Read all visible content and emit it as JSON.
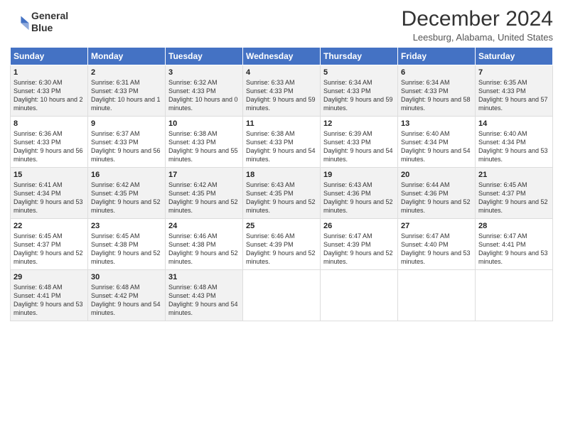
{
  "logo": {
    "line1": "General",
    "line2": "Blue"
  },
  "title": "December 2024",
  "location": "Leesburg, Alabama, United States",
  "header": {
    "save_label": "December 2024",
    "location_label": "Leesburg, Alabama, United States"
  },
  "columns": [
    "Sunday",
    "Monday",
    "Tuesday",
    "Wednesday",
    "Thursday",
    "Friday",
    "Saturday"
  ],
  "weeks": [
    [
      {
        "day": "1",
        "sunrise": "Sunrise: 6:30 AM",
        "sunset": "Sunset: 4:33 PM",
        "daylight": "Daylight: 10 hours and 2 minutes."
      },
      {
        "day": "2",
        "sunrise": "Sunrise: 6:31 AM",
        "sunset": "Sunset: 4:33 PM",
        "daylight": "Daylight: 10 hours and 1 minute."
      },
      {
        "day": "3",
        "sunrise": "Sunrise: 6:32 AM",
        "sunset": "Sunset: 4:33 PM",
        "daylight": "Daylight: 10 hours and 0 minutes."
      },
      {
        "day": "4",
        "sunrise": "Sunrise: 6:33 AM",
        "sunset": "Sunset: 4:33 PM",
        "daylight": "Daylight: 9 hours and 59 minutes."
      },
      {
        "day": "5",
        "sunrise": "Sunrise: 6:34 AM",
        "sunset": "Sunset: 4:33 PM",
        "daylight": "Daylight: 9 hours and 59 minutes."
      },
      {
        "day": "6",
        "sunrise": "Sunrise: 6:34 AM",
        "sunset": "Sunset: 4:33 PM",
        "daylight": "Daylight: 9 hours and 58 minutes."
      },
      {
        "day": "7",
        "sunrise": "Sunrise: 6:35 AM",
        "sunset": "Sunset: 4:33 PM",
        "daylight": "Daylight: 9 hours and 57 minutes."
      }
    ],
    [
      {
        "day": "8",
        "sunrise": "Sunrise: 6:36 AM",
        "sunset": "Sunset: 4:33 PM",
        "daylight": "Daylight: 9 hours and 56 minutes."
      },
      {
        "day": "9",
        "sunrise": "Sunrise: 6:37 AM",
        "sunset": "Sunset: 4:33 PM",
        "daylight": "Daylight: 9 hours and 56 minutes."
      },
      {
        "day": "10",
        "sunrise": "Sunrise: 6:38 AM",
        "sunset": "Sunset: 4:33 PM",
        "daylight": "Daylight: 9 hours and 55 minutes."
      },
      {
        "day": "11",
        "sunrise": "Sunrise: 6:38 AM",
        "sunset": "Sunset: 4:33 PM",
        "daylight": "Daylight: 9 hours and 54 minutes."
      },
      {
        "day": "12",
        "sunrise": "Sunrise: 6:39 AM",
        "sunset": "Sunset: 4:33 PM",
        "daylight": "Daylight: 9 hours and 54 minutes."
      },
      {
        "day": "13",
        "sunrise": "Sunrise: 6:40 AM",
        "sunset": "Sunset: 4:34 PM",
        "daylight": "Daylight: 9 hours and 54 minutes."
      },
      {
        "day": "14",
        "sunrise": "Sunrise: 6:40 AM",
        "sunset": "Sunset: 4:34 PM",
        "daylight": "Daylight: 9 hours and 53 minutes."
      }
    ],
    [
      {
        "day": "15",
        "sunrise": "Sunrise: 6:41 AM",
        "sunset": "Sunset: 4:34 PM",
        "daylight": "Daylight: 9 hours and 53 minutes."
      },
      {
        "day": "16",
        "sunrise": "Sunrise: 6:42 AM",
        "sunset": "Sunset: 4:35 PM",
        "daylight": "Daylight: 9 hours and 52 minutes."
      },
      {
        "day": "17",
        "sunrise": "Sunrise: 6:42 AM",
        "sunset": "Sunset: 4:35 PM",
        "daylight": "Daylight: 9 hours and 52 minutes."
      },
      {
        "day": "18",
        "sunrise": "Sunrise: 6:43 AM",
        "sunset": "Sunset: 4:35 PM",
        "daylight": "Daylight: 9 hours and 52 minutes."
      },
      {
        "day": "19",
        "sunrise": "Sunrise: 6:43 AM",
        "sunset": "Sunset: 4:36 PM",
        "daylight": "Daylight: 9 hours and 52 minutes."
      },
      {
        "day": "20",
        "sunrise": "Sunrise: 6:44 AM",
        "sunset": "Sunset: 4:36 PM",
        "daylight": "Daylight: 9 hours and 52 minutes."
      },
      {
        "day": "21",
        "sunrise": "Sunrise: 6:45 AM",
        "sunset": "Sunset: 4:37 PM",
        "daylight": "Daylight: 9 hours and 52 minutes."
      }
    ],
    [
      {
        "day": "22",
        "sunrise": "Sunrise: 6:45 AM",
        "sunset": "Sunset: 4:37 PM",
        "daylight": "Daylight: 9 hours and 52 minutes."
      },
      {
        "day": "23",
        "sunrise": "Sunrise: 6:45 AM",
        "sunset": "Sunset: 4:38 PM",
        "daylight": "Daylight: 9 hours and 52 minutes."
      },
      {
        "day": "24",
        "sunrise": "Sunrise: 6:46 AM",
        "sunset": "Sunset: 4:38 PM",
        "daylight": "Daylight: 9 hours and 52 minutes."
      },
      {
        "day": "25",
        "sunrise": "Sunrise: 6:46 AM",
        "sunset": "Sunset: 4:39 PM",
        "daylight": "Daylight: 9 hours and 52 minutes."
      },
      {
        "day": "26",
        "sunrise": "Sunrise: 6:47 AM",
        "sunset": "Sunset: 4:39 PM",
        "daylight": "Daylight: 9 hours and 52 minutes."
      },
      {
        "day": "27",
        "sunrise": "Sunrise: 6:47 AM",
        "sunset": "Sunset: 4:40 PM",
        "daylight": "Daylight: 9 hours and 53 minutes."
      },
      {
        "day": "28",
        "sunrise": "Sunrise: 6:47 AM",
        "sunset": "Sunset: 4:41 PM",
        "daylight": "Daylight: 9 hours and 53 minutes."
      }
    ],
    [
      {
        "day": "29",
        "sunrise": "Sunrise: 6:48 AM",
        "sunset": "Sunset: 4:41 PM",
        "daylight": "Daylight: 9 hours and 53 minutes."
      },
      {
        "day": "30",
        "sunrise": "Sunrise: 6:48 AM",
        "sunset": "Sunset: 4:42 PM",
        "daylight": "Daylight: 9 hours and 54 minutes."
      },
      {
        "day": "31",
        "sunrise": "Sunrise: 6:48 AM",
        "sunset": "Sunset: 4:43 PM",
        "daylight": "Daylight: 9 hours and 54 minutes."
      },
      null,
      null,
      null,
      null
    ]
  ]
}
